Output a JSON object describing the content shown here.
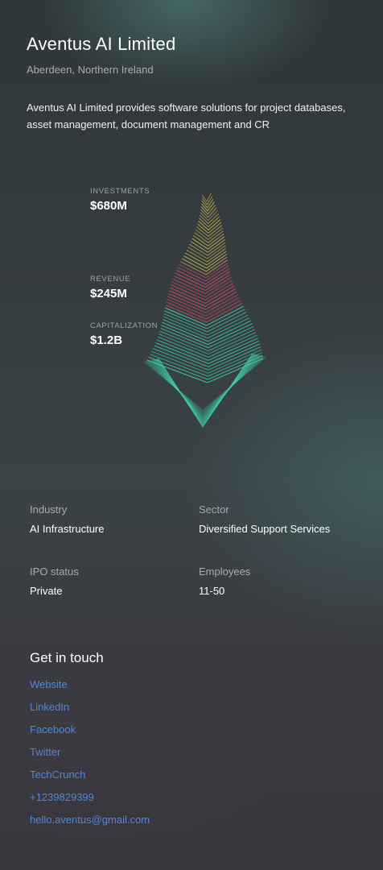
{
  "company": {
    "name": "Aventus AI Limited",
    "location": "Aberdeen, Northern Ireland",
    "description": "Aventus AI Limited provides software solutions for project databases, asset management, document management and CR"
  },
  "stats": [
    {
      "label": "INVESTMENTS",
      "value": "$680M"
    },
    {
      "label": "REVENUE",
      "value": "$245M"
    },
    {
      "label": "CAPITALIZATION",
      "value": "$1.2B"
    }
  ],
  "info": {
    "industry_label": "Industry",
    "industry_value": "AI Infrastructure",
    "sector_label": "Sector",
    "sector_value": "Diversified Support Services",
    "ipo_label": "IPO status",
    "ipo_value": "Private",
    "employees_label": "Employees",
    "employees_value": "11-50"
  },
  "contact": {
    "title": "Get in touch",
    "links": [
      "Website",
      "LinkedIn",
      "Facebook",
      "Twitter",
      "TechCrunch",
      "+1239829399",
      "hello.aventus@gmail.com"
    ]
  },
  "colors": {
    "link": "#4f86d9",
    "investments": "#c9b54a",
    "revenue": "#e0476a",
    "capitalization": "#3fd0b0"
  }
}
